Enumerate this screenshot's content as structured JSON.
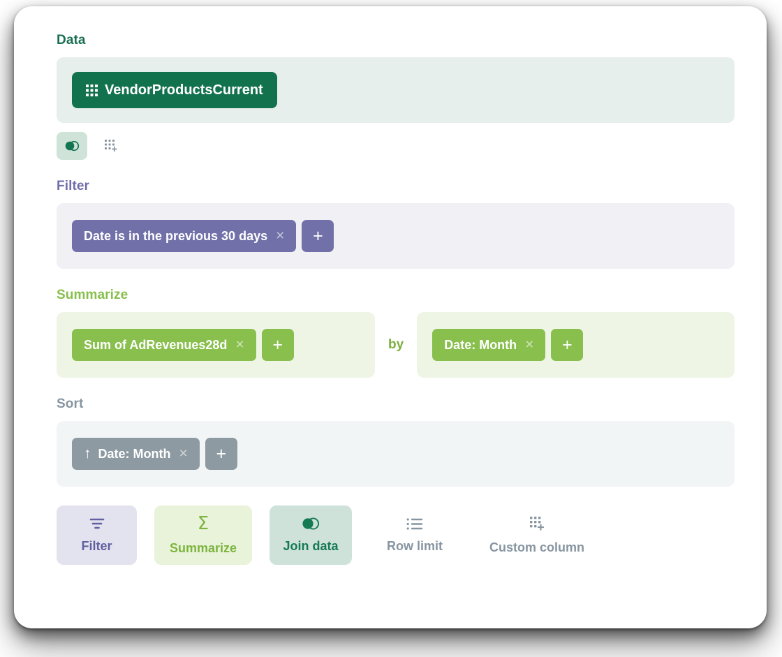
{
  "sections": {
    "data": {
      "label": "Data",
      "table_chip": {
        "name": "VendorProductsCurrent",
        "icon": "table-grid-icon"
      },
      "icons": [
        {
          "name": "join-data-icon",
          "active": true
        },
        {
          "name": "custom-column-icon",
          "active": false
        }
      ]
    },
    "filter": {
      "label": "Filter",
      "chips": [
        {
          "text": "Date is in the previous 30 days",
          "remove": "×"
        }
      ],
      "add_label": "+"
    },
    "summarize": {
      "label": "Summarize",
      "metric_chips": [
        {
          "text": "Sum of AdRevenues28d",
          "remove": "×"
        }
      ],
      "metric_add_label": "+",
      "by_label": "by",
      "breakout_chips": [
        {
          "text": "Date: Month",
          "remove": "×"
        }
      ],
      "breakout_add_label": "+"
    },
    "sort": {
      "label": "Sort",
      "chips": [
        {
          "direction_icon": "↑",
          "text": "Date: Month",
          "remove": "×"
        }
      ],
      "add_label": "+"
    }
  },
  "actionbar": {
    "items": [
      {
        "label": "Filter",
        "icon": "filter-funnel-icon",
        "style": "filter"
      },
      {
        "label": "Summarize",
        "icon": "sigma-icon",
        "style": "summarize"
      },
      {
        "label": "Join data",
        "icon": "join-data-icon",
        "style": "join"
      },
      {
        "label": "Row limit",
        "icon": "list-rows-icon",
        "style": "plain"
      },
      {
        "label": "Custom column",
        "icon": "custom-column-icon",
        "style": "plain"
      }
    ]
  },
  "colors": {
    "data_accent": "#186e50",
    "filter_accent": "#6f6dab",
    "summarize_accent": "#87bf4c",
    "sort_accent": "#8795a1",
    "table_chip_bg": "#13724e",
    "filter_chip_bg": "#7170a9",
    "summarize_chip_bg": "#88bf4d",
    "sort_chip_bg": "#8d9aa2"
  }
}
